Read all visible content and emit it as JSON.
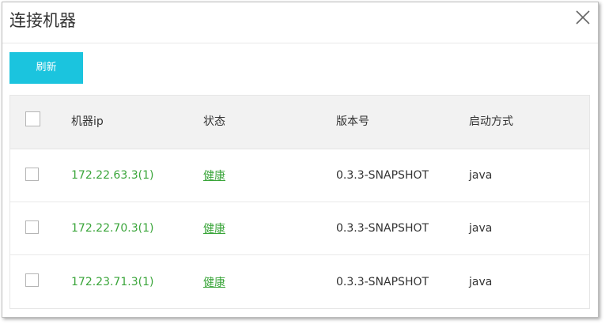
{
  "dialog": {
    "title": "连接机器",
    "refresh_label": "刷新"
  },
  "table": {
    "headers": {
      "ip": "机器ip",
      "status": "状态",
      "version": "版本号",
      "start_mode": "启动方式"
    },
    "rows": [
      {
        "ip": "172.22.63.3(1)",
        "status": "健康",
        "version": "0.3.3-SNAPSHOT",
        "start_mode": "java"
      },
      {
        "ip": "172.22.70.3(1)",
        "status": "健康",
        "version": "0.3.3-SNAPSHOT",
        "start_mode": "java"
      },
      {
        "ip": "172.23.71.3(1)",
        "status": "健康",
        "version": "0.3.3-SNAPSHOT",
        "start_mode": "java"
      }
    ]
  },
  "icons": {
    "close": "close-icon"
  },
  "colors": {
    "accent": "#1bc4de",
    "healthy": "#3aa53a"
  }
}
